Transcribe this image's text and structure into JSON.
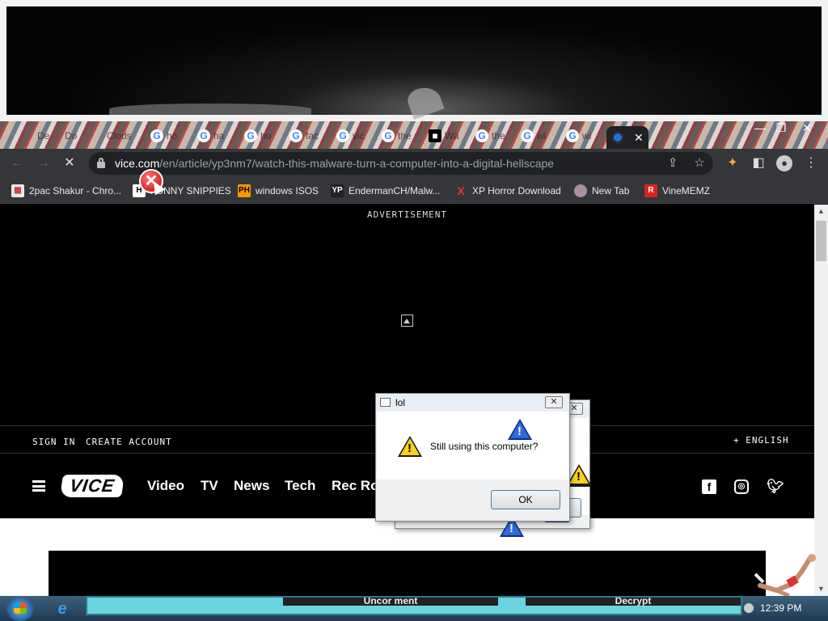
{
  "browser": {
    "tabs": [
      {
        "label": "De"
      },
      {
        "label": "Do"
      },
      {
        "label": "Clods"
      },
      {
        "label": "ho"
      },
      {
        "label": "ha"
      },
      {
        "label": "ho"
      },
      {
        "label": "fac"
      },
      {
        "label": "vic"
      },
      {
        "label": "the"
      },
      {
        "label": "Wa"
      },
      {
        "label": "the"
      },
      {
        "label": "wi"
      },
      {
        "label": "wi"
      }
    ],
    "active_tab_close": "✕",
    "url_host": "vice.com",
    "url_path": "/en/article/yp3nm7/watch-this-malware-turn-a-computer-into-a-digital-hellscape",
    "bookmarks": [
      {
        "label": "2pac Shakur - Chro...",
        "icon": "calendar-icon",
        "icon_text": ""
      },
      {
        "label": "FUNNY SNIPPIES",
        "icon": "h-icon",
        "icon_text": "H"
      },
      {
        "label": "windows ISOS",
        "icon": "ph-icon",
        "icon_text": "PH"
      },
      {
        "label": "EndermanCH/Malw...",
        "icon": "yp-icon",
        "icon_text": "YP"
      },
      {
        "label": "XP Horror Download",
        "icon": "x-icon",
        "icon_text": "X"
      },
      {
        "label": "New Tab",
        "icon": "globe-icon",
        "icon_text": ""
      },
      {
        "label": "VineMEMZ",
        "icon": "r-icon",
        "icon_text": "R"
      }
    ]
  },
  "page": {
    "advertisement_label": "ADVERTISEMENT",
    "account": {
      "sign_in": "SIGN IN",
      "create_account": "CREATE ACCOUNT",
      "language": "+ ENGLISH"
    },
    "logo_text": "VICE",
    "nav_links": [
      "Video",
      "TV",
      "News",
      "Tech",
      "Rec Ro"
    ]
  },
  "dialog": {
    "title": "lol",
    "message": "Still using this computer?",
    "ok_label": "OK",
    "close_glyph": "✕"
  },
  "taskbar": {
    "task_buttons": [
      "Uncor   ment",
      "Decrypt"
    ],
    "clock": "12:39 PM"
  },
  "colors": {
    "chrome_dark": "#35363a",
    "omnibox": "#202124",
    "warning_yellow": "#f9d21b",
    "task_strip": "#6ad4e0"
  }
}
